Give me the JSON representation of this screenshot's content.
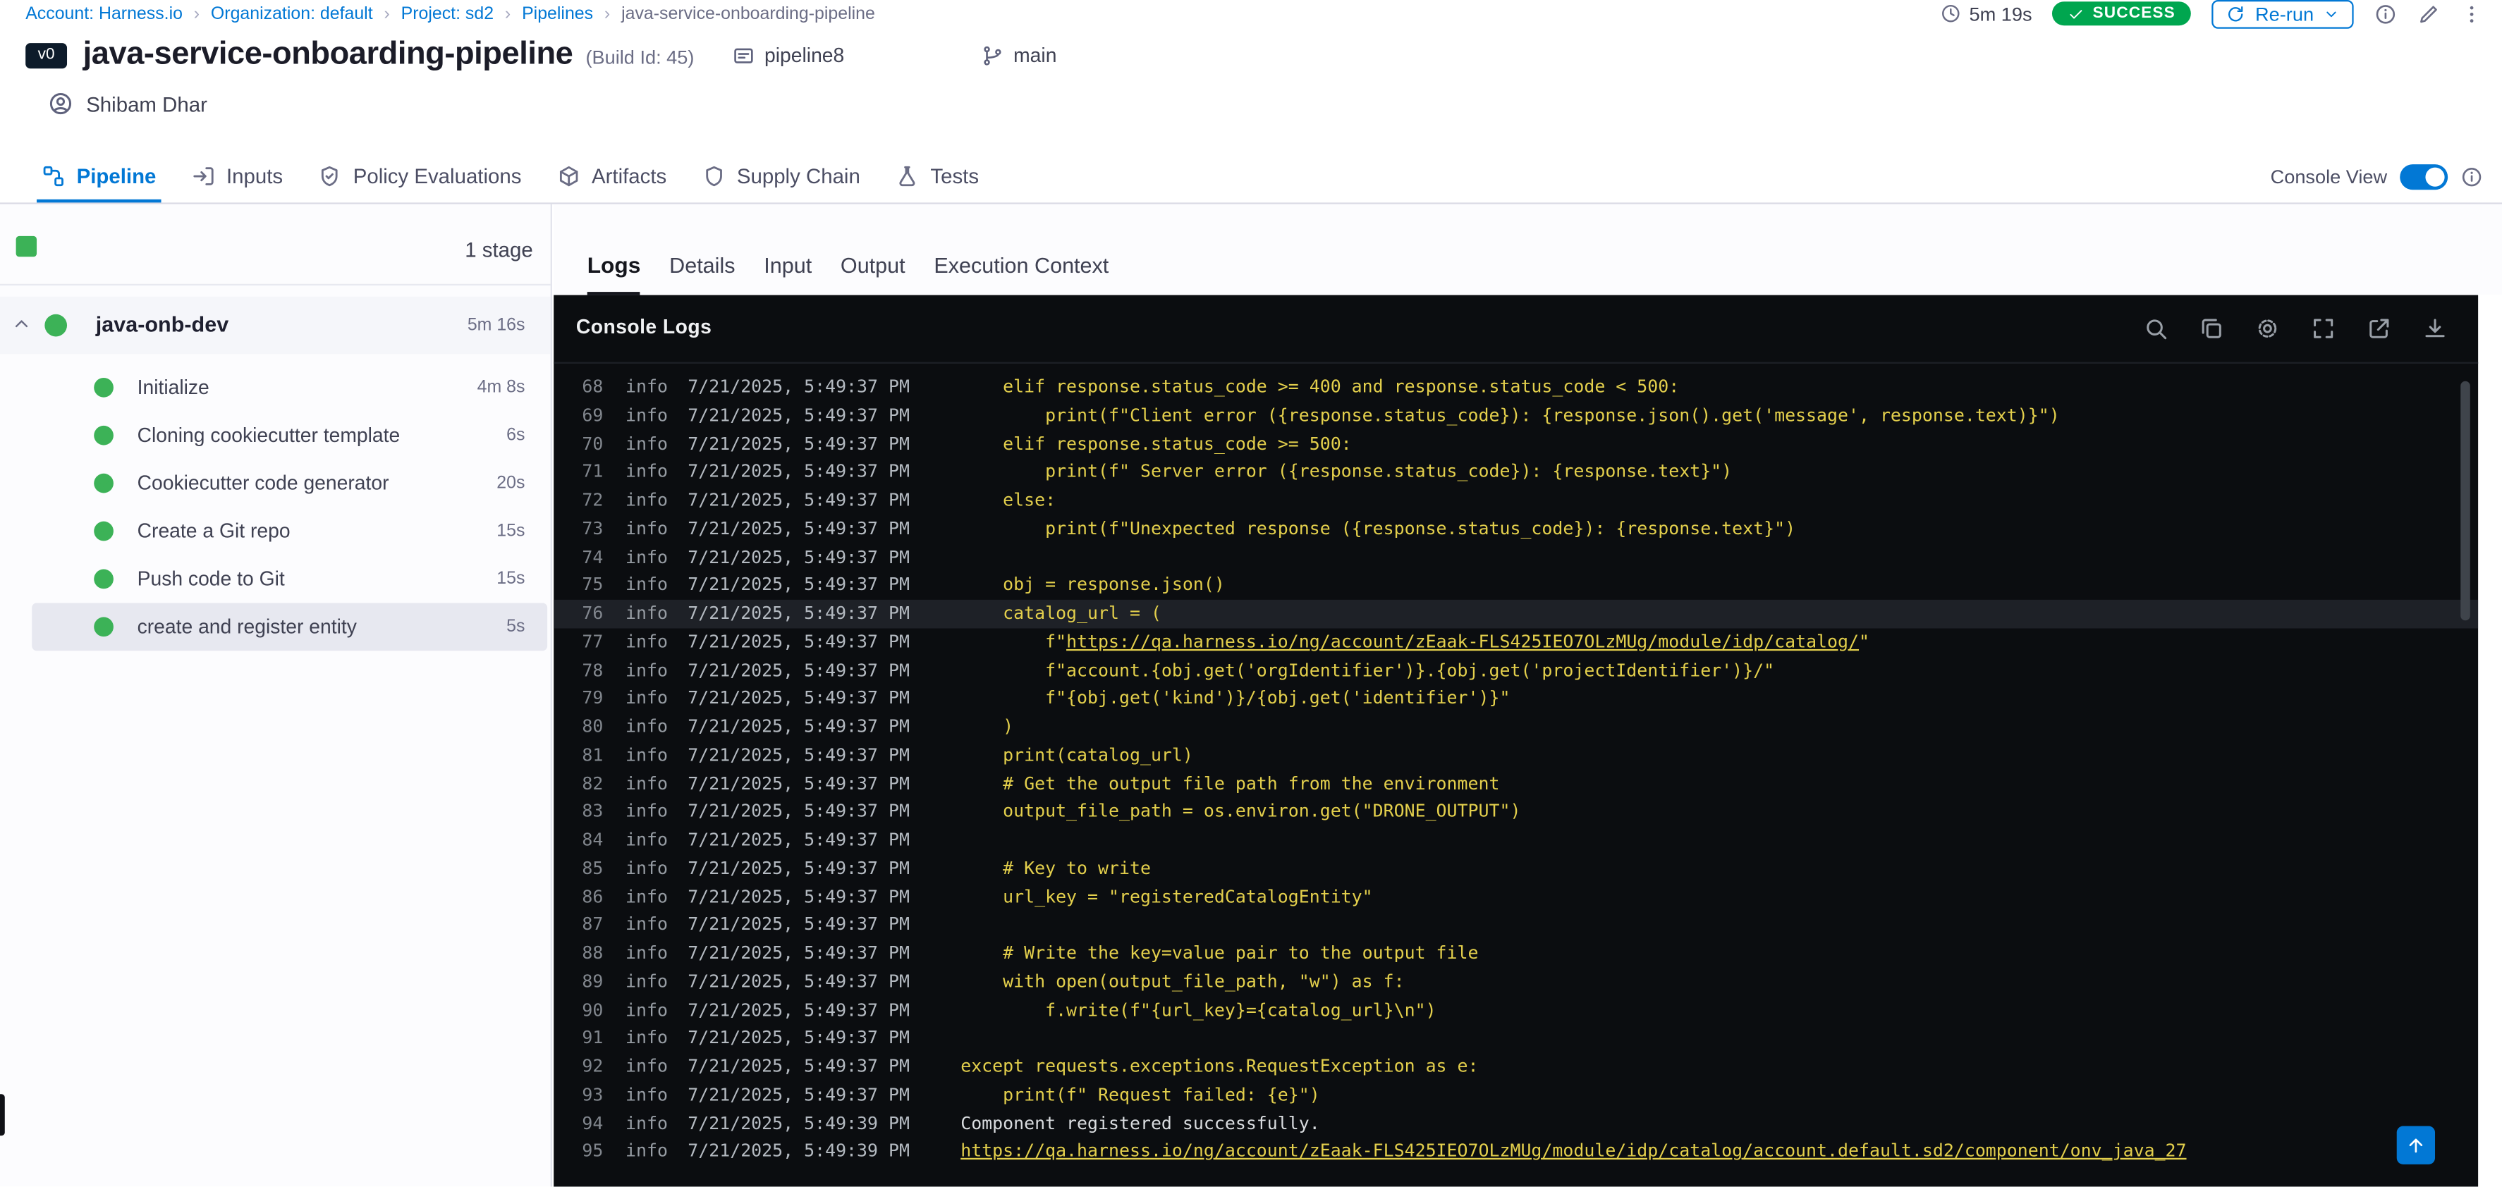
{
  "breadcrumb": {
    "items": [
      "Account: Harness.io",
      "Organization: default",
      "Project: sd2",
      "Pipelines",
      "java-service-onboarding-pipeline"
    ]
  },
  "topbar": {
    "duration": "5m 19s",
    "status": "SUCCESS",
    "rerun": "Re-run"
  },
  "header": {
    "version": "v0",
    "title": "java-service-onboarding-pipeline",
    "build": "(Build Id: 45)",
    "template": "pipeline8",
    "branch": "main",
    "user": "Shibam Dhar"
  },
  "tabs": {
    "pipeline": "Pipeline",
    "inputs": "Inputs",
    "policy": "Policy Evaluations",
    "artifacts": "Artifacts",
    "supply": "Supply Chain",
    "tests": "Tests",
    "console_view": "Console View"
  },
  "stages": {
    "count": "1 stage",
    "stage_name": "java-onb-dev",
    "stage_duration": "5m 16s",
    "steps": [
      {
        "name": "Initialize",
        "duration": "4m 8s"
      },
      {
        "name": "Cloning cookiecutter template",
        "duration": "6s"
      },
      {
        "name": "Cookiecutter code generator",
        "duration": "20s"
      },
      {
        "name": "Create a Git repo",
        "duration": "15s"
      },
      {
        "name": "Push code to Git",
        "duration": "15s"
      },
      {
        "name": "create and register entity",
        "duration": "5s",
        "selected": true
      }
    ]
  },
  "log_tabs": {
    "logs": "Logs",
    "details": "Details",
    "input": "Input",
    "output": "Output",
    "execution": "Execution Context"
  },
  "console": {
    "title": "Console Logs",
    "level_label": "info",
    "accent_colors": {
      "code_yellow": "#e3cf4c",
      "plain_white": "#d9dcdf",
      "panel_bg": "#0b0d10",
      "primary_blue": "#0278d5",
      "success_green": "#00a64f",
      "check_green": "#3cb257"
    },
    "lines": [
      {
        "n": 68,
        "t": "7/21/2025, 5:49:37 PM",
        "seg": [
          [
            "c",
            "    elif response.status_code >= 400 and response.status_code < 500:"
          ]
        ]
      },
      {
        "n": 69,
        "t": "7/21/2025, 5:49:37 PM",
        "seg": [
          [
            "c",
            "        print(f\"Client error ({response.status_code}): {response.json().get('message', response.text)}\")"
          ]
        ]
      },
      {
        "n": 70,
        "t": "7/21/2025, 5:49:37 PM",
        "seg": [
          [
            "c",
            "    elif response.status_code >= 500:"
          ]
        ]
      },
      {
        "n": 71,
        "t": "7/21/2025, 5:49:37 PM",
        "seg": [
          [
            "c",
            "        print(f\" Server error ({response.status_code}): {response.text}\")"
          ]
        ]
      },
      {
        "n": 72,
        "t": "7/21/2025, 5:49:37 PM",
        "seg": [
          [
            "c",
            "    else:"
          ]
        ]
      },
      {
        "n": 73,
        "t": "7/21/2025, 5:49:37 PM",
        "seg": [
          [
            "c",
            "        print(f\"Unexpected response ({response.status_code}): {response.text}\")"
          ]
        ]
      },
      {
        "n": 74,
        "t": "7/21/2025, 5:49:37 PM",
        "seg": []
      },
      {
        "n": 75,
        "t": "7/21/2025, 5:49:37 PM",
        "seg": [
          [
            "c",
            "    obj = response.json()"
          ]
        ]
      },
      {
        "n": 76,
        "t": "7/21/2025, 5:49:37 PM",
        "hl": true,
        "seg": [
          [
            "c",
            "    catalog_url = ("
          ]
        ]
      },
      {
        "n": 77,
        "t": "7/21/2025, 5:49:37 PM",
        "seg": [
          [
            "c",
            "        f\""
          ],
          [
            "lk",
            "https://qa.harness.io/ng/account/zEaak-FLS425IEO7OLzMUg/module/idp/catalog/"
          ],
          [
            "c",
            "\""
          ]
        ]
      },
      {
        "n": 78,
        "t": "7/21/2025, 5:49:37 PM",
        "seg": [
          [
            "c",
            "        f\"account.{obj.get('orgIdentifier')}.{obj.get('projectIdentifier')}/\""
          ]
        ]
      },
      {
        "n": 79,
        "t": "7/21/2025, 5:49:37 PM",
        "seg": [
          [
            "c",
            "        f\"{obj.get('kind')}/{obj.get('identifier')}\""
          ]
        ]
      },
      {
        "n": 80,
        "t": "7/21/2025, 5:49:37 PM",
        "seg": [
          [
            "c",
            "    )"
          ]
        ]
      },
      {
        "n": 81,
        "t": "7/21/2025, 5:49:37 PM",
        "seg": [
          [
            "c",
            "    print(catalog_url)"
          ]
        ]
      },
      {
        "n": 82,
        "t": "7/21/2025, 5:49:37 PM",
        "seg": [
          [
            "c",
            "    # Get the output file path from the environment"
          ]
        ]
      },
      {
        "n": 83,
        "t": "7/21/2025, 5:49:37 PM",
        "seg": [
          [
            "c",
            "    output_file_path = os.environ.get(\"DRONE_OUTPUT\")"
          ]
        ]
      },
      {
        "n": 84,
        "t": "7/21/2025, 5:49:37 PM",
        "seg": []
      },
      {
        "n": 85,
        "t": "7/21/2025, 5:49:37 PM",
        "seg": [
          [
            "c",
            "    # Key to write"
          ]
        ]
      },
      {
        "n": 86,
        "t": "7/21/2025, 5:49:37 PM",
        "seg": [
          [
            "c",
            "    url_key = \"registeredCatalogEntity\""
          ]
        ]
      },
      {
        "n": 87,
        "t": "7/21/2025, 5:49:37 PM",
        "seg": []
      },
      {
        "n": 88,
        "t": "7/21/2025, 5:49:37 PM",
        "seg": [
          [
            "c",
            "    # Write the key=value pair to the output file"
          ]
        ]
      },
      {
        "n": 89,
        "t": "7/21/2025, 5:49:37 PM",
        "seg": [
          [
            "c",
            "    with open(output_file_path, \"w\") as f:"
          ]
        ]
      },
      {
        "n": 90,
        "t": "7/21/2025, 5:49:37 PM",
        "seg": [
          [
            "c",
            "        f.write(f\"{url_key}={catalog_url}\\n\")"
          ]
        ]
      },
      {
        "n": 91,
        "t": "7/21/2025, 5:49:37 PM",
        "seg": []
      },
      {
        "n": 92,
        "t": "7/21/2025, 5:49:37 PM",
        "seg": [
          [
            "c",
            "except requests.exceptions.RequestException as e:"
          ]
        ]
      },
      {
        "n": 93,
        "t": "7/21/2025, 5:49:37 PM",
        "seg": [
          [
            "c",
            "    print(f\" Request failed: {e}\")"
          ]
        ]
      },
      {
        "n": 94,
        "t": "7/21/2025, 5:49:39 PM",
        "seg": [
          [
            "pl",
            "Component registered successfully."
          ]
        ]
      },
      {
        "n": 95,
        "t": "7/21/2025, 5:49:39 PM",
        "seg": [
          [
            "lk",
            "https://qa.harness.io/ng/account/zEaak-FLS425IEO7OLzMUg/module/idp/catalog/account.default.sd2/component/onv_java_27"
          ]
        ]
      }
    ]
  }
}
